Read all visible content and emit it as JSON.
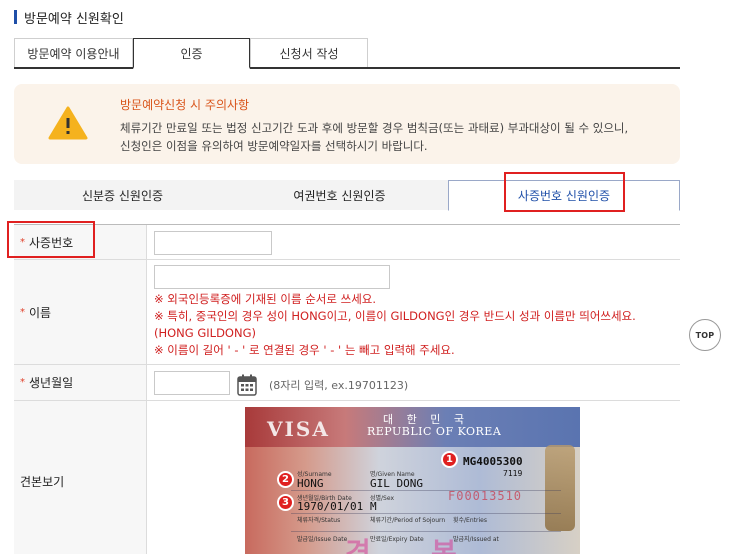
{
  "page_title": "방문예약 신원확인",
  "tabs": [
    {
      "label": "방문예약 이용안내"
    },
    {
      "label": "인증"
    },
    {
      "label": "신청서 작성"
    }
  ],
  "notice": {
    "title": "방문예약신청 시 주의사항",
    "line1": "체류기간 만료일 또는 법정 신고기간 도과 후에 방문할 경우 범칙금(또는 과태료) 부과대상이 될 수 있으니,",
    "line2": "신청인은 이점을 유의하여 방문예약일자를 선택하시기 바랍니다."
  },
  "subtabs": [
    {
      "label": "신분증 신원인증"
    },
    {
      "label": "여권번호 신원인증"
    },
    {
      "label": "사증번호 신원인증"
    }
  ],
  "form": {
    "visa_number_label": "사증번호",
    "name_label": "이름",
    "name_notes": [
      "※ 외국인등록증에 기재된 이름 순서로 쓰세요.",
      "※ 특히, 중국인의 경우 성이 HONG이고, 이름이 GILDONG인 경우 반드시 성과 이름만 띄어쓰세요.",
      "(HONG GILDONG)",
      "※ 이름이 길어 ' - ' 로 연결된 경우 ' - ' 는 빼고 입력해 주세요."
    ],
    "birth_label": "생년월일",
    "birth_hint": "(8자리 입력, ex.19701123)",
    "sample_label": "견본보기",
    "required_mark": "*"
  },
  "sample_visa": {
    "visa_word": "VISA",
    "korean_title": "대 한 민 국",
    "country": "REPUBLIC OF KOREA",
    "number": "MG4005300",
    "small_code": "7119",
    "surname_label": "성/Surname",
    "surname": "HONG",
    "given_label": "명/Given Name",
    "given": "GIL DONG",
    "dob_label": "생년월일/Birth Date",
    "dob": "1970/01/01",
    "sex_label": "성별/Sex",
    "sex": "M",
    "mrz": "F00013510",
    "status_label": "체류자격/Status",
    "period_label": "체류기간/Period of Sojourn",
    "entries_label": "횟수/Entries",
    "issue_label": "발급일/Issue Date",
    "expiry_label": "만료일/Expiry Date",
    "issued_at_label": "발급지/Issued at",
    "badges": [
      "1",
      "2",
      "3"
    ]
  },
  "top_button": "TOP",
  "colors": {
    "accent": "#1f4fa8",
    "warning": "#d9541a",
    "highlight": "#e02020"
  }
}
